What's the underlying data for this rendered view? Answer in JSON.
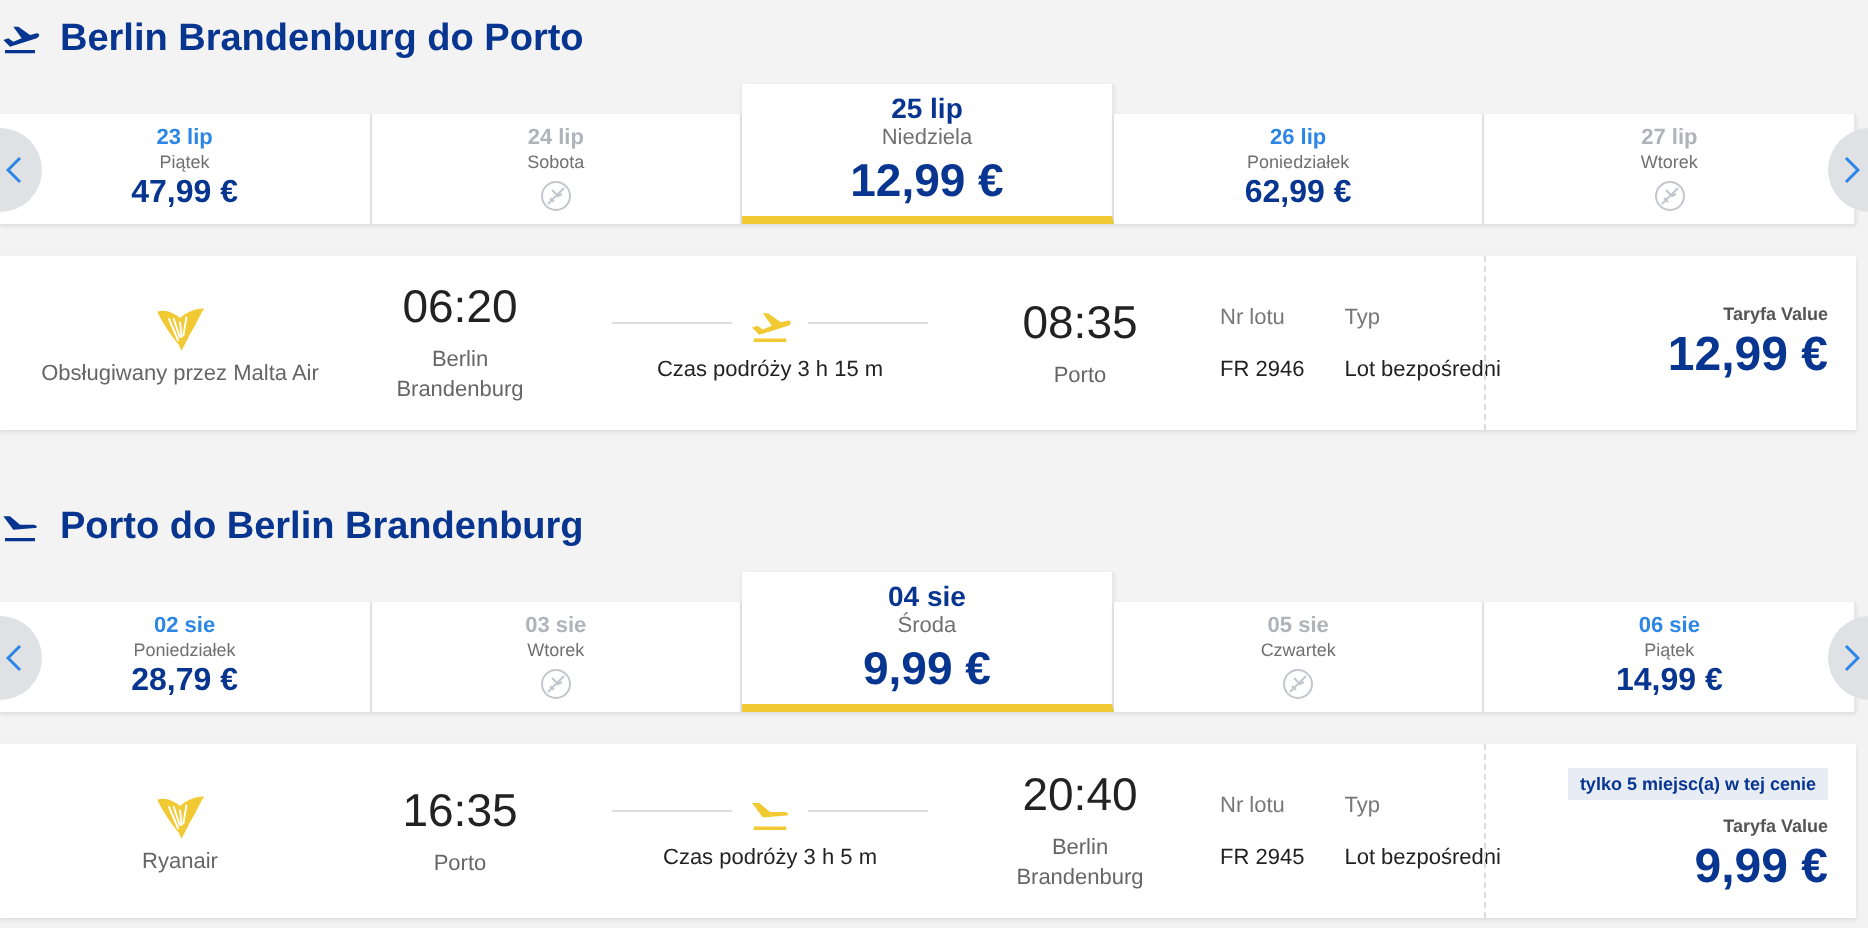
{
  "sections": [
    {
      "title": "Berlin Brandenburg do Porto",
      "kind": "outbound",
      "dates": [
        {
          "date": "23 lip",
          "day": "Piątek",
          "kind": "price",
          "price": "47,99 €",
          "selected": false
        },
        {
          "date": "24 lip",
          "day": "Sobota",
          "kind": "unavailable",
          "selected": false
        },
        {
          "date": "25 lip",
          "day": "Niedziela",
          "kind": "price",
          "price": "12,99 €",
          "selected": true
        },
        {
          "date": "26 lip",
          "day": "Poniedziałek",
          "kind": "price",
          "price": "62,99 €",
          "selected": false
        },
        {
          "date": "27 lip",
          "day": "Wtorek",
          "kind": "unavailable",
          "selected": false
        }
      ],
      "flight": {
        "airline": "Obsługiwany przez Malta Air",
        "departure_time": "06:20",
        "departure_city": "Berlin Brandenburg",
        "duration": "Czas podróży 3 h 15 m",
        "arrival_time": "08:35",
        "arrival_city": "Porto",
        "flight_number_label": "Nr lotu",
        "flight_number": "FR 2946",
        "type_label": "Typ",
        "type": "Lot bezpośredni",
        "fare_label": "Taryfa Value",
        "fare_price": "12,99 €"
      }
    },
    {
      "title": "Porto do Berlin Brandenburg",
      "kind": "return",
      "dates": [
        {
          "date": "02 sie",
          "day": "Poniedziałek",
          "kind": "price",
          "price": "28,79 €",
          "selected": false
        },
        {
          "date": "03 sie",
          "day": "Wtorek",
          "kind": "unavailable",
          "selected": false
        },
        {
          "date": "04 sie",
          "day": "Środa",
          "kind": "price",
          "price": "9,99 €",
          "selected": true
        },
        {
          "date": "05 sie",
          "day": "Czwartek",
          "kind": "unavailable",
          "selected": false
        },
        {
          "date": "06 sie",
          "day": "Piątek",
          "kind": "price",
          "price": "14,99 €",
          "selected": false
        }
      ],
      "flight": {
        "airline": "Ryanair",
        "departure_time": "16:35",
        "departure_city": "Porto",
        "duration": "Czas podróży 3 h 5 m",
        "arrival_time": "20:40",
        "arrival_city": "Berlin Brandenburg",
        "flight_number_label": "Nr lotu",
        "flight_number": "FR 2945",
        "type_label": "Typ",
        "type": "Lot bezpośredni",
        "seats_badge": "tylko 5 miejsc(a) w tej cenie",
        "fare_label": "Taryfa Value",
        "fare_price": "9,99 €"
      }
    }
  ]
}
